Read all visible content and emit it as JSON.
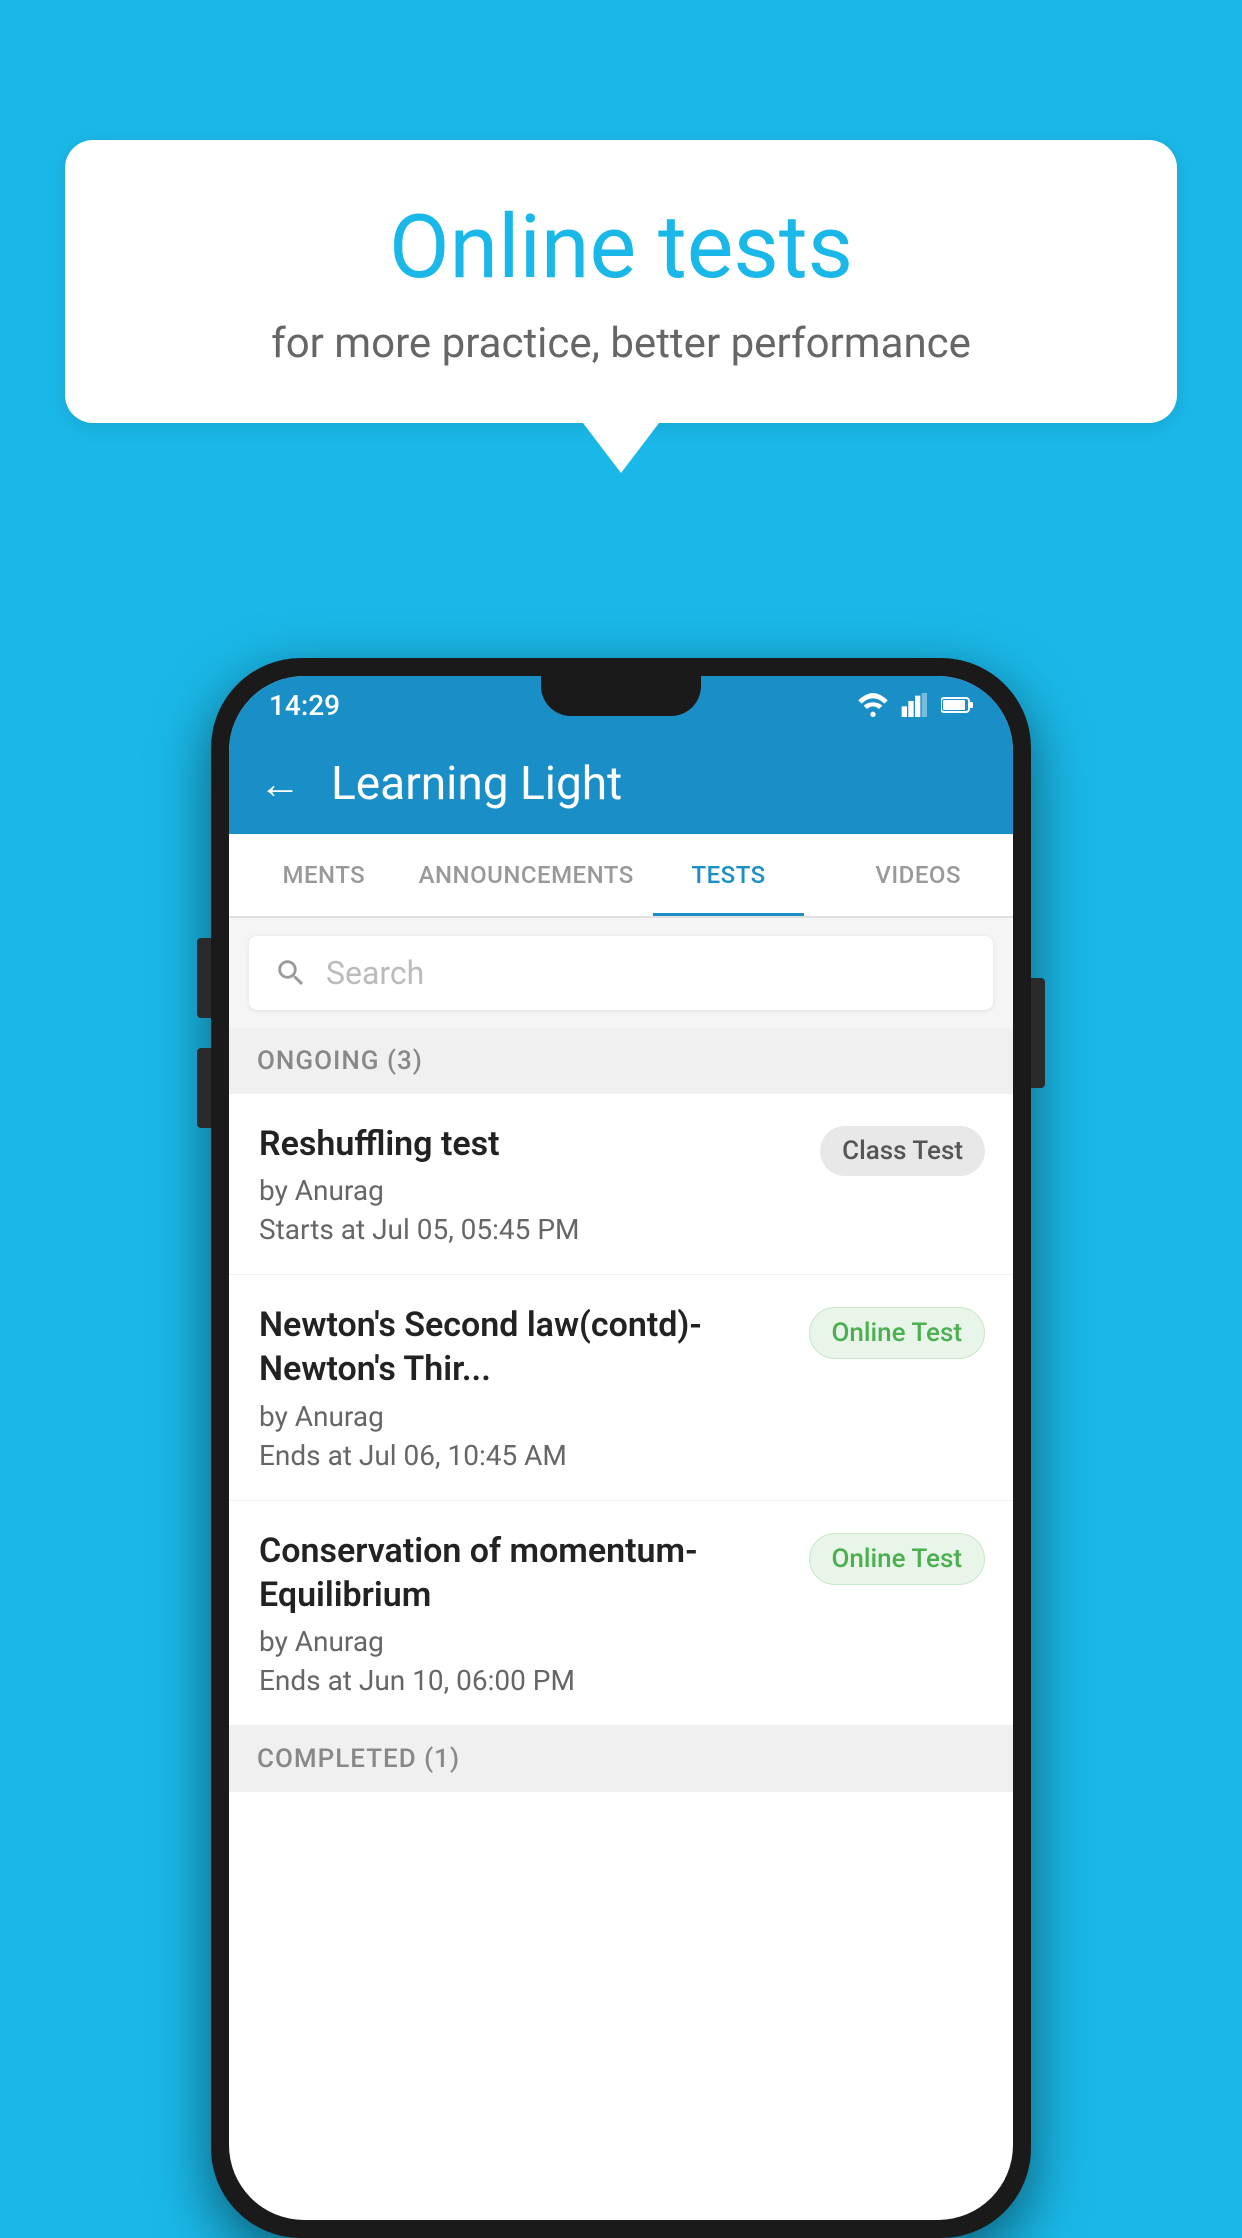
{
  "background_color": "#1ab8e8",
  "speech_bubble": {
    "title": "Online tests",
    "subtitle": "for more practice, better performance"
  },
  "phone": {
    "status_bar": {
      "time": "14:29"
    },
    "app_bar": {
      "title": "Learning Light",
      "back_label": "←"
    },
    "tabs": [
      {
        "label": "MENTS",
        "active": false
      },
      {
        "label": "ANNOUNCEMENTS",
        "active": false
      },
      {
        "label": "TESTS",
        "active": true
      },
      {
        "label": "VIDEOS",
        "active": false
      }
    ],
    "search": {
      "placeholder": "Search"
    },
    "ongoing_section": {
      "label": "ONGOING (3)"
    },
    "test_items": [
      {
        "title": "Reshuffling test",
        "author": "by Anurag",
        "date": "Starts at  Jul 05, 05:45 PM",
        "badge": "Class Test",
        "badge_type": "class"
      },
      {
        "title": "Newton's Second law(contd)-Newton's Thir...",
        "author": "by Anurag",
        "date": "Ends at  Jul 06, 10:45 AM",
        "badge": "Online Test",
        "badge_type": "online"
      },
      {
        "title": "Conservation of momentum-Equilibrium",
        "author": "by Anurag",
        "date": "Ends at  Jun 10, 06:00 PM",
        "badge": "Online Test",
        "badge_type": "online"
      }
    ],
    "completed_section": {
      "label": "COMPLETED (1)"
    }
  }
}
